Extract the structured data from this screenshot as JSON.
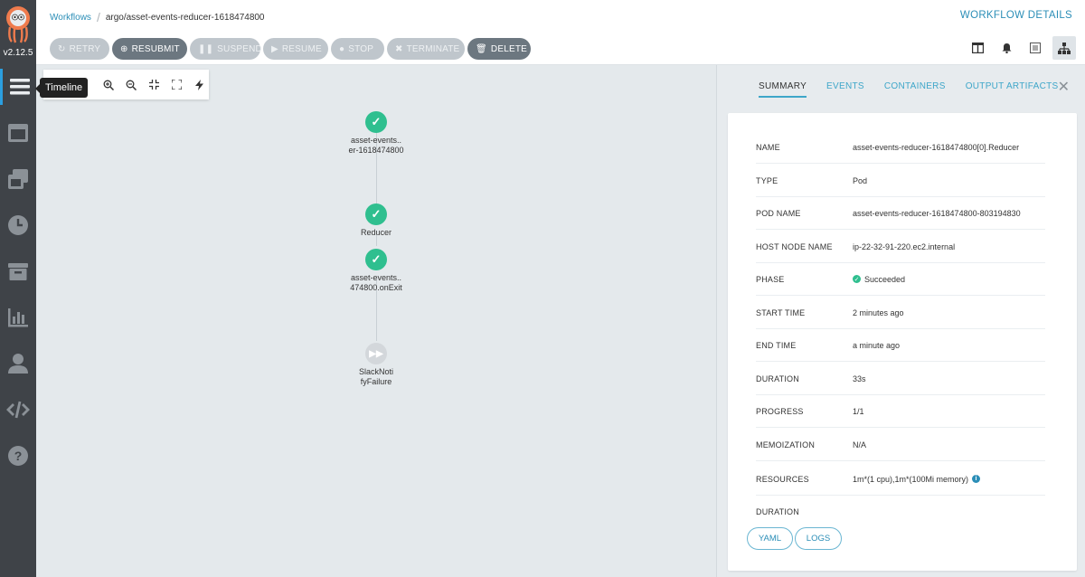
{
  "app": {
    "version": "v2.12.5"
  },
  "sidebar": {
    "tooltip": "Timeline",
    "items": [
      {
        "icon": "timeline-icon",
        "active": true
      },
      {
        "icon": "workflow-templates-icon",
        "active": false
      },
      {
        "icon": "cluster-templates-icon",
        "active": false
      },
      {
        "icon": "cron-workflows-icon",
        "active": false
      },
      {
        "icon": "archived-workflows-icon",
        "active": false
      },
      {
        "icon": "reports-icon",
        "active": false
      },
      {
        "icon": "user-icon",
        "active": false
      },
      {
        "icon": "api-docs-icon",
        "active": false
      },
      {
        "icon": "help-icon",
        "active": false
      }
    ]
  },
  "header": {
    "breadcrumb": {
      "root": "Workflows",
      "current": "argo/asset-events-reducer-1618474800"
    },
    "title": "WORKFLOW DETAILS",
    "actions": [
      {
        "label": "RETRY",
        "icon": "↻",
        "style": "light"
      },
      {
        "label": "RESUBMIT",
        "icon": "⊕",
        "style": "dark"
      },
      {
        "label": "SUSPEND",
        "icon": "❚❚",
        "style": "light"
      },
      {
        "label": "RESUME",
        "icon": "▶",
        "style": "light"
      },
      {
        "label": "STOP",
        "icon": "●",
        "style": "light"
      },
      {
        "label": "TERMINATE",
        "icon": "✖",
        "style": "light"
      },
      {
        "label": "DELETE",
        "icon": "🗑",
        "style": "dark"
      }
    ],
    "views": [
      "split-view-icon",
      "bell-icon",
      "summary-icon",
      "graph-icon"
    ]
  },
  "graph": {
    "toolbar": [
      "zoom-in-icon",
      "zoom-out-icon",
      "fit-icon",
      "fullscreen-icon",
      "fast-icon"
    ],
    "nodes": [
      {
        "label_line1": "asset-events..",
        "label_line2": "er-1618474800",
        "status": "succeeded"
      },
      {
        "label_line1": "Reducer",
        "label_line2": "",
        "status": "succeeded"
      },
      {
        "label_line1": "asset-events..",
        "label_line2": "474800.onExit",
        "status": "succeeded"
      },
      {
        "label_line1": "SlackNoti",
        "label_line2": "fyFailure",
        "status": "skipped"
      }
    ]
  },
  "panel": {
    "tabs": [
      "SUMMARY",
      "EVENTS",
      "CONTAINERS",
      "OUTPUT ARTIFACTS"
    ],
    "active_tab": "SUMMARY",
    "rows": [
      {
        "key": "NAME",
        "value": "asset-events-reducer-1618474800[0].Reducer"
      },
      {
        "key": "TYPE",
        "value": "Pod"
      },
      {
        "key": "POD NAME",
        "value": "asset-events-reducer-1618474800-803194830"
      },
      {
        "key": "HOST NODE NAME",
        "value": "ip-22-32-91-220.ec2.internal"
      },
      {
        "key": "PHASE",
        "value": "Succeeded"
      },
      {
        "key": "START TIME",
        "value": "2 minutes ago"
      },
      {
        "key": "END TIME",
        "value": "a minute ago"
      },
      {
        "key": "DURATION",
        "value": "33s"
      },
      {
        "key": "PROGRESS",
        "value": "1/1"
      },
      {
        "key": "MEMOIZATION",
        "value": "N/A"
      },
      {
        "key": "RESOURCES",
        "value": "1m*(1 cpu),1m*(100Mi memory)"
      },
      {
        "key": "DURATION",
        "value": ""
      }
    ],
    "buttons": {
      "yaml": "YAML",
      "logs": "LOGS"
    }
  },
  "colors": {
    "success": "#2fbf8f",
    "accent": "#2b8eb7",
    "sidebar": "#3f4348"
  }
}
